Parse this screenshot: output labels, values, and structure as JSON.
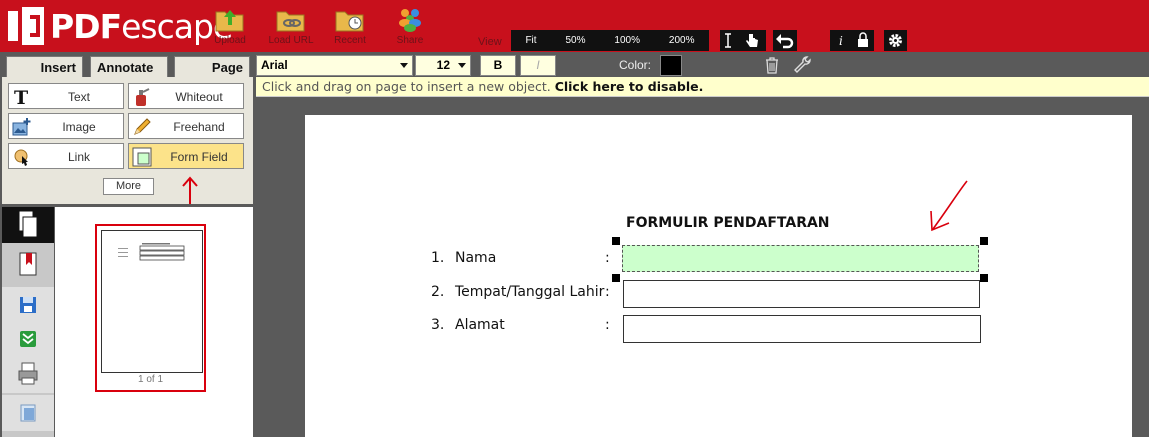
{
  "app": {
    "logo_text_bold": "PDF",
    "logo_text_light": "escape"
  },
  "toolbar": {
    "upload": "Upload",
    "load_url": "Load URL",
    "recent": "Recent",
    "share": "Share",
    "view_label": "View",
    "zoom_options": [
      "Fit",
      "50%",
      "100%",
      "200%"
    ]
  },
  "tabs": {
    "insert": "Insert",
    "annotate": "Annotate",
    "page": "Page"
  },
  "props": {
    "font": "Arial",
    "size": "12",
    "bold": "B",
    "italic": "I",
    "color_label": "Color:",
    "color_value": "#000000"
  },
  "tools": {
    "text": "Text",
    "whiteout": "Whiteout",
    "image": "Image",
    "freehand": "Freehand",
    "link": "Link",
    "form_field": "Form Field",
    "more": "More"
  },
  "hint": {
    "text": "Click and drag on page to insert a new object.",
    "action": "Click here to disable."
  },
  "thumbnails": {
    "caption": "1 of 1"
  },
  "document": {
    "title": "FORMULIR PENDAFTARAN",
    "rows": [
      {
        "num": "1.",
        "label": "Nama",
        "colon": ":"
      },
      {
        "num": "2.",
        "label": "Tempat/Tanggal Lahir",
        "colon": ":"
      },
      {
        "num": "3.",
        "label": "Alamat",
        "colon": ":"
      }
    ]
  },
  "colors": {
    "brand": "#c8101c",
    "active_tool": "#fce38a",
    "annotation": "#d9000d",
    "active_field": "#ccffcc"
  }
}
